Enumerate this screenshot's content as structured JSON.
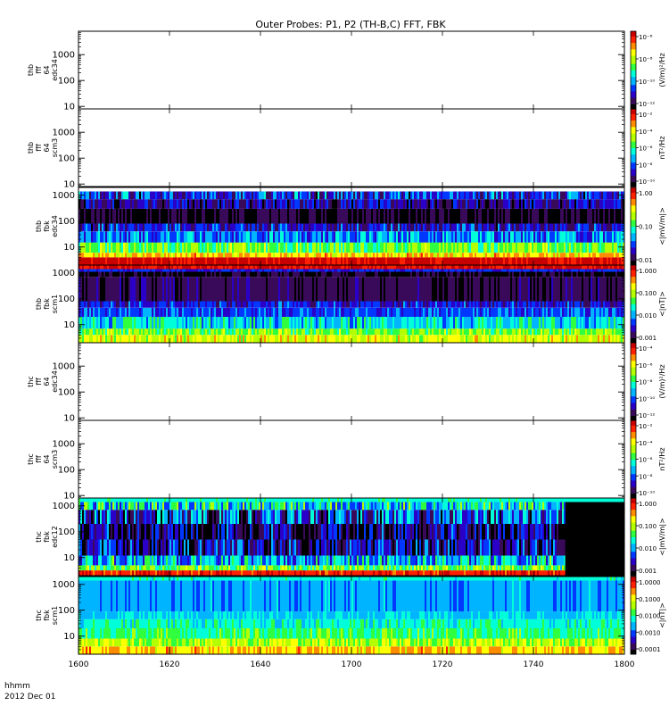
{
  "title": "Outer Probes: P1, P2 (TH-B,C) FFT, FBK",
  "time_axis": {
    "label_line1": "hhmm",
    "label_line2": "2012 Dec 01",
    "ticks": [
      "1600",
      "1620",
      "1640",
      "1700",
      "1720",
      "1740",
      "1800"
    ]
  },
  "colormap": [
    "#000000",
    "#3a0a5a",
    "#2a00c8",
    "#0038ff",
    "#00b4ff",
    "#00ffd8",
    "#30ff40",
    "#b4ff00",
    "#ffff00",
    "#ff8c00",
    "#ff2000",
    "#c80000"
  ],
  "chart_data": [
    {
      "type": "heatmap",
      "panel": "thb-fff-64-edc34",
      "ylabel": [
        "thb",
        "fff",
        "64",
        "edc34"
      ],
      "yaxis": "log",
      "ylim": [
        8,
        8000
      ],
      "yticks": [
        "10",
        "100",
        "1000"
      ],
      "colorbar_label": "(V/m)²/Hz",
      "colorbar_ticks": [
        "10⁻¹²",
        "10⁻¹⁰",
        "10⁻⁸",
        "10⁻⁶"
      ],
      "has_data": false
    },
    {
      "type": "heatmap",
      "panel": "thb-fff-64-scm3",
      "ylabel": [
        "thb",
        "fff",
        "64",
        "scm3"
      ],
      "yaxis": "log",
      "ylim": [
        8,
        8000
      ],
      "yticks": [
        "10",
        "100",
        "1000"
      ],
      "colorbar_label": "nT²/Hz",
      "colorbar_ticks": [
        "10⁻¹⁰",
        "10⁻⁸",
        "10⁻⁶",
        "10⁻⁴",
        "10⁻²"
      ],
      "has_data": false
    },
    {
      "type": "heatmap",
      "panel": "thb-fbk-edc34",
      "ylabel": [
        "thb",
        "fbk",
        "edc34"
      ],
      "yaxis": "log",
      "ylim": [
        2,
        2000
      ],
      "yticks": [
        "10",
        "100",
        "1000"
      ],
      "colorbar_label": "<|mV/m|>",
      "colorbar_ticks": [
        "0.01",
        "0.10",
        "1.00"
      ],
      "has_data": true,
      "bands": [
        {
          "f_lo": 2,
          "f_hi": 4,
          "level": 10.8,
          "var": 0.6
        },
        {
          "f_lo": 4,
          "f_hi": 6,
          "level": 8.2,
          "var": 1.2
        },
        {
          "f_lo": 6,
          "f_hi": 15,
          "level": 6.3,
          "var": 1.2
        },
        {
          "f_lo": 15,
          "f_hi": 40,
          "level": 3.6,
          "var": 1.5
        },
        {
          "f_lo": 40,
          "f_hi": 80,
          "level": 2.2,
          "var": 1.6
        },
        {
          "f_lo": 80,
          "f_hi": 300,
          "level": 0.4,
          "var": 0.8
        },
        {
          "f_lo": 300,
          "f_hi": 700,
          "level": 1.6,
          "var": 1.6
        },
        {
          "f_lo": 700,
          "f_hi": 1400,
          "level": 2.6,
          "var": 2.0
        }
      ]
    },
    {
      "type": "heatmap",
      "panel": "thb-fbk-scm1",
      "ylabel": [
        "thb",
        "fbk",
        "scm1"
      ],
      "yaxis": "log",
      "ylim": [
        2,
        2000
      ],
      "yticks": [
        "10",
        "100",
        "1000"
      ],
      "colorbar_label": "<|nT|>",
      "colorbar_ticks": [
        "0.001",
        "0.010",
        "0.100",
        "1.000"
      ],
      "has_data": true,
      "bands": [
        {
          "f_lo": 2,
          "f_hi": 4,
          "level": 7.6,
          "var": 1.2
        },
        {
          "f_lo": 4,
          "f_hi": 7,
          "level": 6.4,
          "var": 1.2
        },
        {
          "f_lo": 7,
          "f_hi": 20,
          "level": 4.6,
          "var": 1.4
        },
        {
          "f_lo": 20,
          "f_hi": 45,
          "level": 3.1,
          "var": 1.0
        },
        {
          "f_lo": 45,
          "f_hi": 80,
          "level": 2.4,
          "var": 1.2
        },
        {
          "f_lo": 80,
          "f_hi": 700,
          "level": 0.9,
          "var": 0.7
        },
        {
          "f_lo": 700,
          "f_hi": 1100,
          "level": 0.4,
          "var": 0.5
        },
        {
          "f_lo": 1100,
          "f_hi": 1400,
          "level": 2.6,
          "var": 0.5
        },
        {
          "f_lo": 1400,
          "f_hi": 2000,
          "level": 10.6,
          "var": 0.5
        }
      ]
    },
    {
      "type": "heatmap",
      "panel": "thc-fff-64-edc34",
      "ylabel": [
        "thc",
        "fff",
        "64",
        "edc34"
      ],
      "yaxis": "log",
      "ylim": [
        8,
        8000
      ],
      "yticks": [
        "10",
        "100",
        "1000"
      ],
      "colorbar_label": "(V/m)²/Hz",
      "colorbar_ticks": [
        "10⁻¹²",
        "10⁻¹⁰",
        "10⁻⁸",
        "10⁻⁶",
        "10⁻⁴"
      ],
      "has_data": false
    },
    {
      "type": "heatmap",
      "panel": "thc-fff-64-scm3",
      "ylabel": [
        "thc",
        "fff",
        "64",
        "scm3"
      ],
      "yaxis": "log",
      "ylim": [
        8,
        8000
      ],
      "yticks": [
        "10",
        "100",
        "1000"
      ],
      "colorbar_label": "nT²/Hz",
      "colorbar_ticks": [
        "10⁻¹⁰",
        "10⁻⁸",
        "10⁻⁶",
        "10⁻⁴",
        "10⁻²"
      ],
      "has_data": false
    },
    {
      "type": "heatmap",
      "panel": "thc-fbk-edc12",
      "ylabel": [
        "thc",
        "fbk",
        "edc12"
      ],
      "yaxis": "log",
      "ylim": [
        2,
        2000
      ],
      "yticks": [
        "10",
        "100",
        "1000"
      ],
      "colorbar_label": "<|mV/m|>",
      "colorbar_ticks": [
        "0.001",
        "0.010",
        "0.100",
        "1.000"
      ],
      "has_data": true,
      "data_end_time": "1747",
      "bands": [
        {
          "f_lo": 2,
          "f_hi": 3.2,
          "level": 10.2,
          "var": 0.8
        },
        {
          "f_lo": 3.2,
          "f_hi": 5,
          "level": 6.2,
          "var": 1.6
        },
        {
          "f_lo": 5,
          "f_hi": 12,
          "level": 4.2,
          "var": 2.2
        },
        {
          "f_lo": 12,
          "f_hi": 50,
          "level": 1.8,
          "var": 2.4
        },
        {
          "f_lo": 50,
          "f_hi": 200,
          "level": 1.2,
          "var": 2.4
        },
        {
          "f_lo": 200,
          "f_hi": 700,
          "level": 2.6,
          "var": 2.6
        },
        {
          "f_lo": 700,
          "f_hi": 1400,
          "level": 4.8,
          "var": 2.4
        },
        {
          "f_lo": 1400,
          "f_hi": 2000,
          "level": 5.2,
          "var": 0.4
        }
      ]
    },
    {
      "type": "heatmap",
      "panel": "thc-fbk-scm1",
      "ylabel": [
        "thc",
        "fbk",
        "scm1"
      ],
      "yaxis": "log",
      "ylim": [
        2,
        2000
      ],
      "yticks": [
        "10",
        "100",
        "1000"
      ],
      "colorbar_label": "<|nT|>",
      "colorbar_ticks": [
        "0.0001",
        "0.0010",
        "0.0100",
        "0.1000",
        "1.0000"
      ],
      "has_data": true,
      "bands": [
        {
          "f_lo": 2,
          "f_hi": 4,
          "level": 8.4,
          "var": 1.0
        },
        {
          "f_lo": 4,
          "f_hi": 8,
          "level": 7.0,
          "var": 1.2
        },
        {
          "f_lo": 8,
          "f_hi": 20,
          "level": 5.8,
          "var": 1.0
        },
        {
          "f_lo": 20,
          "f_hi": 45,
          "level": 5.0,
          "var": 0.8
        },
        {
          "f_lo": 45,
          "f_hi": 90,
          "level": 4.4,
          "var": 0.4
        },
        {
          "f_lo": 90,
          "f_hi": 1400,
          "level": 3.8,
          "var": 0.6
        },
        {
          "f_lo": 1400,
          "f_hi": 2000,
          "level": 5.0,
          "var": 0.4
        }
      ]
    }
  ]
}
